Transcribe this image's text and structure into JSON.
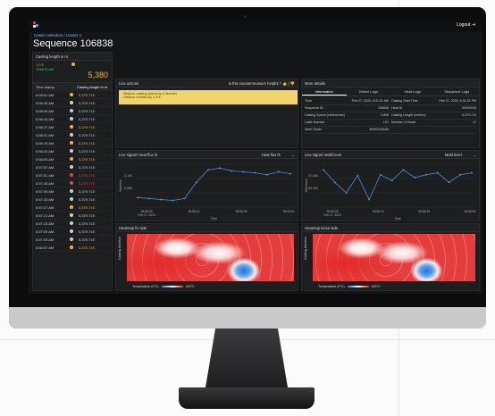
{
  "app": {
    "logout_label": "Logout"
  },
  "breadcrumb": {
    "first": "Caster selection",
    "separator": "/",
    "second": "Caster 1"
  },
  "page_title": "Sequence 106838",
  "casting": {
    "header": "Casting length in m",
    "status_line1": "LIVE",
    "status_line2": "6:58:51 AM",
    "value": "5,380",
    "col_time": "Time stamp",
    "col_length": "Casting length in m",
    "rows": [
      {
        "time": "6:58:51 AM",
        "value": "5,379.715",
        "color": "#f3b22c"
      },
      {
        "time": "6:58:45 AM",
        "value": "5,379.715",
        "color": "#cfcfcf"
      },
      {
        "time": "6:58:39 AM",
        "value": "5,379.715",
        "color": "#cfcfcf"
      },
      {
        "time": "6:58:33 AM",
        "value": "5,379.715",
        "color": "#cfcfcf"
      },
      {
        "time": "6:58:27 AM",
        "value": "5,379.715",
        "color": "#f3b22c"
      },
      {
        "time": "6:58:21 AM",
        "value": "5,379.715",
        "color": "#cfcfcf"
      },
      {
        "time": "6:58:15 AM",
        "value": "5,379.715",
        "color": "#f3b22c"
      },
      {
        "time": "6:58:09 AM",
        "value": "5,379.715",
        "color": "#cfcfcf"
      },
      {
        "time": "6:58:03 AM",
        "value": "5,379.715",
        "color": "#f3b22c"
      },
      {
        "time": "6:57:57 AM",
        "value": "5,379.715",
        "color": "#cfcfcf"
      },
      {
        "time": "6:57:51 AM",
        "value": "5,379.715",
        "color": "#e04a4a"
      },
      {
        "time": "6:57:45 AM",
        "value": "5,379.715",
        "color": "#e04a4a"
      },
      {
        "time": "6:57:39 AM",
        "value": "5,379.715",
        "color": "#cfcfcf"
      },
      {
        "time": "6:57:33 AM",
        "value": "5,379.715",
        "color": "#cfcfcf"
      },
      {
        "time": "6:57:27 AM",
        "value": "5,379.715",
        "color": "#f3b22c"
      },
      {
        "time": "6:57:21 AM",
        "value": "5,379.715",
        "color": "#cfcfcf"
      },
      {
        "time": "6:57:15 AM",
        "value": "5,379.715",
        "color": "#cfcfcf"
      },
      {
        "time": "6:57:09 AM",
        "value": "5,379.715",
        "color": "#cfcfcf"
      },
      {
        "time": "6:57:03 AM",
        "value": "5,379.715",
        "color": "#cfcfcf"
      },
      {
        "time": "6:56:57 AM",
        "value": "5,379.715",
        "color": "#f3b22c"
      }
    ]
  },
  "live_actions": {
    "header": "Live actions",
    "question": "Is this countermeasure helpful ?",
    "line1": "- Reduce casting speed by 0.3m/min",
    "line2": "- Reduce tundish by 1.2%"
  },
  "more_details": {
    "header": "More details",
    "tabs": [
      "Information",
      "Defect Logs",
      "Heat Logs",
      "Sequence Logs"
    ],
    "rows": [
      {
        "k1": "Time",
        "v1": "Feb 27, 2020, 8:31:31 AM",
        "k2": "Casting Start Time",
        "v2": "Feb 27, 2020, 6:31:31 PM"
      },
      {
        "k1": "Sequence ID",
        "v1": "106838",
        "k2": "Heat ID",
        "v2": "20009916"
      },
      {
        "k1": "Casting Speed (meters/min)",
        "v1": "0.898",
        "k2": "Casting Length (meters)",
        "v2": "5,379.715"
      },
      {
        "k1": "Ladle Number",
        "v1": "L01",
        "k2": "Number of Heats",
        "v2": "17"
      },
      {
        "k1": "Steel Grade",
        "v1": "J0900224A09",
        "k2": "",
        "v2": ""
      }
    ]
  },
  "heat_flux_chart": {
    "header": "Live signal: Heat flux fs",
    "dropdown": "Heat flux fs",
    "ylabel": "Heat flux",
    "xlabel": "Time",
    "date_label": "Feb 27, 2020"
  },
  "mold_level_chart": {
    "header": "Live signal: Mold level",
    "dropdown": "Mold level",
    "ylabel": "Mold level",
    "xlabel": "Time",
    "date_label": "Feb 27, 2020"
  },
  "chart_data": [
    {
      "type": "line",
      "x": [
        "08:58:05",
        "08:58:20",
        "08:58:35",
        "08:58:50"
      ],
      "values": [
        0.085,
        0.084,
        0.083,
        0.082,
        0.084,
        0.101,
        0.114,
        0.116,
        0.113,
        0.112,
        0.111,
        0.109,
        0.112,
        0.11
      ],
      "yticks": [
        "0.100",
        "0.080"
      ],
      "ylim": [
        0.075,
        0.12
      ],
      "color": "#4f8ed9"
    },
    {
      "type": "line",
      "x": [
        "08:58:05",
        "08:58:20",
        "08:58:35",
        "08:58:50"
      ],
      "values": [
        68.4,
        67.1,
        66.0,
        67.8,
        65.3,
        67.9,
        67.3,
        68.4,
        67.6,
        67.9,
        68.1,
        67.1,
        67.9,
        68.1
      ],
      "yticks": [
        "67.000",
        "66.000"
      ],
      "ylim": [
        64.5,
        69.0
      ],
      "color": "#4f8ed9"
    }
  ],
  "heatmap_fix": {
    "header": "Heatmap fix side",
    "axis": "Casting direction",
    "legend_label": "Temperature (0°C)",
    "legend_max": "400°C"
  },
  "heatmap_loose": {
    "header": "Heatmap loose side",
    "axis": "Casting direction",
    "legend_label": "Temperature (0°C)",
    "legend_max": "400°C"
  }
}
